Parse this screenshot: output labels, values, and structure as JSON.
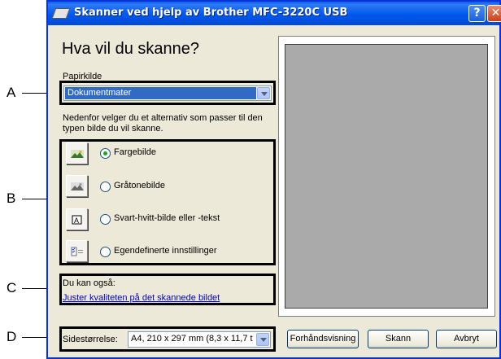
{
  "callouts": {
    "a": "A",
    "b": "B",
    "c": "C",
    "d": "D"
  },
  "window": {
    "title": "Skanner ved hjelp av Brother MFC-3220C USB",
    "help_glyph": "?",
    "close_glyph": "✕"
  },
  "main": {
    "heading": "Hva vil du skanne?",
    "paper_source_label": "Papirkilde",
    "paper_source_value": "Dokumentmater",
    "description": "Nedenfor velger du et alternativ som passer til den typen bilde du vil skanne.",
    "options": [
      {
        "label": "Fargebilde",
        "checked": true,
        "icon": "color-photo-icon"
      },
      {
        "label": "Gråtonebilde",
        "checked": false,
        "icon": "grayscale-photo-icon"
      },
      {
        "label": "Svart-hvitt-bilde eller -tekst",
        "checked": false,
        "icon": "black-white-text-icon"
      },
      {
        "label": "Egendefinerte innstillinger",
        "checked": false,
        "icon": "custom-settings-icon"
      }
    ],
    "also_label": "Du kan også:",
    "quality_link": "Juster kvaliteten på det skannede bildet"
  },
  "bottom": {
    "page_size_label": "Sidestørrelse:",
    "page_size_value": "A4, 210 x 297 mm (8,3 x 11,7 t",
    "preview_button": "Forhåndsvisning",
    "scan_button": "Skann",
    "cancel_button": "Avbryt"
  },
  "colors": {
    "titlebar": "#0058ee",
    "dialog_bg": "#ece9d8",
    "selection": "#316ac5",
    "preview_gray": "#aaaaaa",
    "link": "#0000cc"
  }
}
